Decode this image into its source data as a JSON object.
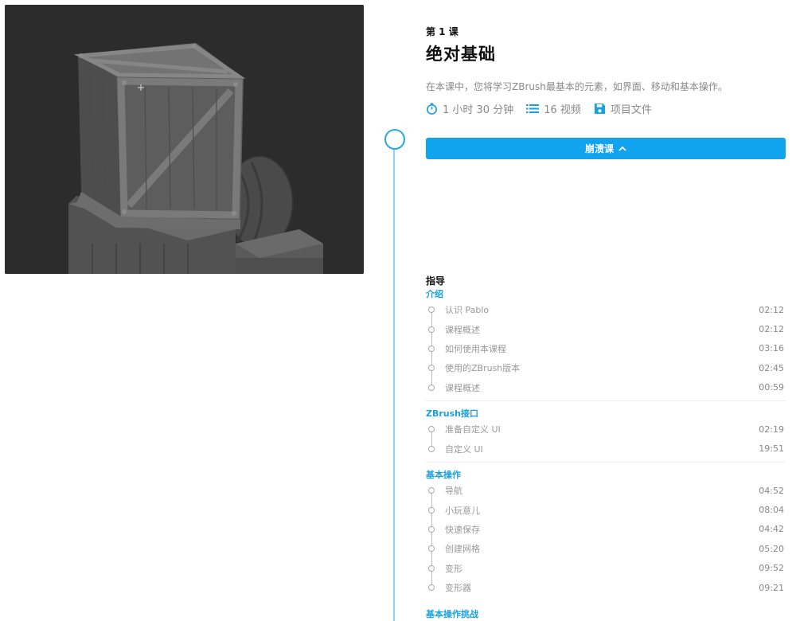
{
  "lesson": {
    "number": "第 1 课",
    "title": "绝对基础",
    "description": "在本课中，您将学习ZBrush最基本的元素，如界面、移动和基本操作。",
    "duration": "1 小时 30 分钟",
    "video_count": "16 视频",
    "project_files": "项目文件",
    "collapse_label": "崩溃课"
  },
  "guide": {
    "title": "指导",
    "sections": [
      {
        "title": "介绍",
        "items": [
          {
            "label": "认识 Pablo",
            "time": "02:12"
          },
          {
            "label": "课程概述",
            "time": "02:12"
          },
          {
            "label": "如何使用本课程",
            "time": "03:16"
          },
          {
            "label": "使用的ZBrush版本",
            "time": "02:45"
          },
          {
            "label": "课程概述",
            "time": "00:59"
          }
        ]
      },
      {
        "title": "ZBrush接口",
        "items": [
          {
            "label": "准备自定义 UI",
            "time": "02:19"
          },
          {
            "label": "自定义 UI",
            "time": "19:51"
          }
        ]
      },
      {
        "title": "基本操作",
        "items": [
          {
            "label": "导航",
            "time": "04:52"
          },
          {
            "label": "小玩意儿",
            "time": "08:04"
          },
          {
            "label": "快速保存",
            "time": "04:42"
          },
          {
            "label": "创建网格",
            "time": "05:20"
          },
          {
            "label": "变形",
            "time": "09:52"
          },
          {
            "label": "变形器",
            "time": "09:21"
          }
        ]
      },
      {
        "title": "基本操作挑战",
        "items": []
      }
    ]
  },
  "colors": {
    "accent": "#10a3ee",
    "section_title": "#1aa1dd",
    "timeline": "#8fd3ef"
  },
  "icons": {
    "duration": "stopwatch-icon",
    "videos": "list-icon",
    "files": "floppy-disk-icon",
    "collapse": "chevron-up-icon"
  }
}
